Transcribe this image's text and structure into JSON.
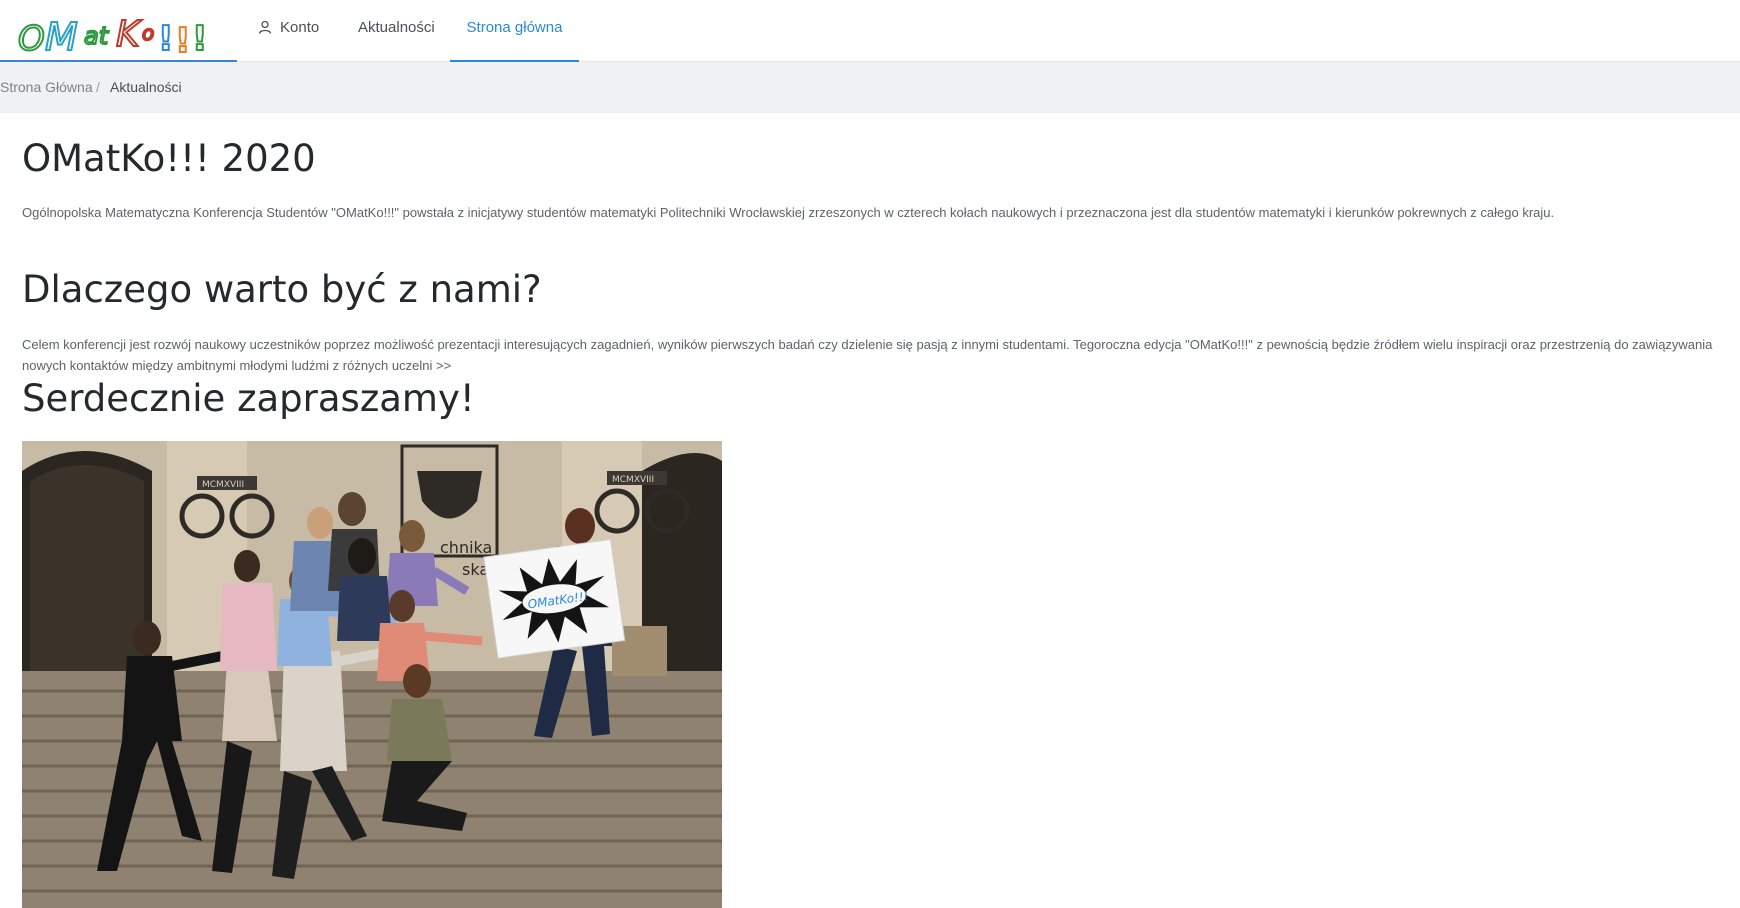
{
  "header": {
    "logo_text": "OMatKo!!!",
    "nav": {
      "account": "Konto",
      "news": "Aktualności",
      "home": "Strona główna"
    }
  },
  "breadcrumb": {
    "home": "Strona Główna",
    "separator": "/",
    "current": "Aktualności"
  },
  "content": {
    "title": "OMatKo!!! 2020",
    "intro": "Ogólnopolska Matematyczna Konferencja Studentów \"OMatKo!!!\" powstała z inicjatywy studentów matematyki Politechniki Wrocławskiej zrzeszonych w czterech kołach naukowych i przeznaczona jest dla studentów matematyki i kierunków pokrewnych z całego kraju.",
    "why_heading": "Dlaczego warto być z nami?",
    "why_text": "Celem konferencji jest rozwój naukowy uczestników poprzez możliwość prezentacji interesujących zagadnień, wyników pierwszych badań czy dzielenie się pasją z innymi studentami. Tegoroczna edycja \"OMatKo!!!\" z pewnością będzie źródłem wielu inspiracji oraz przestrzenią do zawiązywania nowych kontaktów między ambitnymi młodymi ludźmi z różnych uczelni >>",
    "invite": "Serdecznie zapraszamy!"
  },
  "photo": {
    "inscription_left": "MCMXVIII",
    "inscription_right": "MCMXVIII",
    "building_text_1": "chnika",
    "building_text_2": "ska"
  },
  "colors": {
    "accent": "#2a8ad8",
    "breadcrumb_bg": "#eff1f3"
  },
  "icons": {
    "account": "user-icon"
  }
}
